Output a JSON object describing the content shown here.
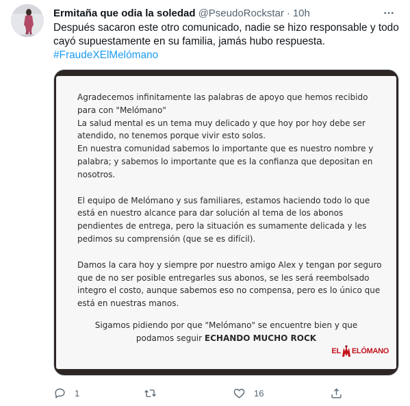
{
  "tweet": {
    "author_name": "Ermitaña que odia la soledad",
    "handle": "@PseudoRockstar",
    "separator": "·",
    "time": "10h",
    "text_lines": [
      "Después sacaron este otro comunicado, nadie se hizo responsable y todo",
      "cayó supuestamente en su familia, jamás hubo respuesta."
    ],
    "hashtag": "#FraudeXElMelómano"
  },
  "document": {
    "paragraphs": [
      [
        "Agradecemos infinitamente las palabras de apoyo que hemos recibido",
        "para con \"Melómano\"",
        "La salud mental es un tema muy delicado y que hoy por hoy debe ser",
        "atendido, no tenemos porque vivir esto solos.",
        "En nuestra comunidad sabemos lo importante que es nuestro nombre y",
        "palabra; y sabemos lo importante que es la confianza que depositan en",
        "nosotros."
      ],
      [
        "El equipo de Melómano y sus familiares, estamos haciendo todo lo que",
        "está en nuestro alcance para dar solución al tema de los abonos",
        "pendientes de entrega, pero la situación es sumamente delicada y les",
        "pedimos su comprensión (que se es difícil)."
      ],
      [
        "Damos la cara hoy y siempre por nuestro amigo Alex y tengan por seguro",
        "que de no ser posible entregarles sus abonos, se les será reembolsado",
        "integro el costo, aunque sabemos eso no compensa, pero es lo único que",
        "está en nuestras manos."
      ]
    ],
    "closing_line1": "Sigamos pidiendo por que \"Melómano\" se encuentre bien y que",
    "closing_line2_prefix": "podamos seguir ",
    "closing_line2_bold": "ECHANDO MUCHO ROCK",
    "brand_left": "EL",
    "brand_right": "ELÓMANO",
    "brand_color": "#c2121c"
  },
  "actions": {
    "reply_count": "1",
    "retweet_count": "",
    "like_count": "16"
  },
  "icons": {
    "more": "more-icon",
    "reply": "reply-icon",
    "retweet": "retweet-icon",
    "like": "like-icon",
    "share": "share-icon"
  },
  "colors": {
    "link": "#1d9bf0",
    "muted": "#536471",
    "text": "#0f1419"
  }
}
